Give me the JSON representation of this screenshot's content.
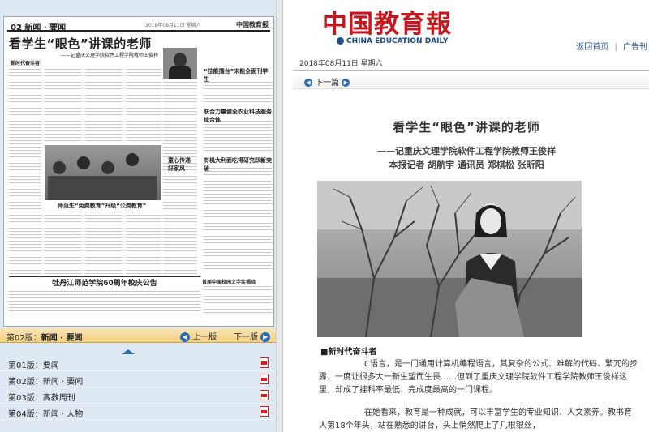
{
  "newspaper_thumb": {
    "edition": "02 新闻 · 要闻",
    "date": "2018年08月11日 星期六",
    "logo": "中国教育报",
    "headline": "看学生“眼色”讲课的老师",
    "subhead": "——记重庆文理学院软件工程学院教师王俊祥",
    "section_label": "新时代奋斗者",
    "side_headline": "“技能擂台”未能全面刊学生",
    "brief_1": "联合力量健全农业科技服务综合体",
    "brief_2": "有机大利面吃得研究跃新突破",
    "photo_caption": "师范生“免费教育”升级“公费教育”",
    "photo_title": "童心传递好家风",
    "announcement": "牡丹江师范学院60周年校庆公告",
    "announcement_2": "首届中国校园文学奖揭晓"
  },
  "page_nav": {
    "current_prefix": "第02版：",
    "current_name": "新闻 · 要闻",
    "prev_label": "上一版",
    "next_label": "下一版"
  },
  "page_list": [
    {
      "label": "第01版：要闻"
    },
    {
      "label": "第02版：新闻 · 要闻"
    },
    {
      "label": "第03版：高教周刊"
    },
    {
      "label": "第04版：新闻 · 人物"
    }
  ],
  "header": {
    "brand": "中国教育報",
    "brand_en": "CHINA EDUCATION DAILY",
    "home_link": "返回首页",
    "ad_link": "广告刊",
    "separator": "|",
    "date": "2018年08月11日 星期六",
    "next_article": "下一篇"
  },
  "article": {
    "title": "看学生“眼色”讲课的老师",
    "subtitle": "——记重庆文理学院软件工程学院教师王俊祥",
    "byline": "本报记者 胡航宇 通讯员 郑棋松 张昕阳",
    "section": "■新时代奋斗者",
    "paragraph_1": "C语言，是一门通用计算机编程语言，其复杂的公式、难解的代码、繁冗的步骤，一度让很多大一新生望而生畏……但到了重庆文理学院软件工程学院教师王俊祥这里，却成了挂科率最低、完成度最高的一门课程。",
    "paragraph_2": "在她看来，教育是一种成就，可以丰富学生的专业知识、人文素养。教书育人第18个年头，站在熟悉的讲台，头上悄然爬上了几根银丝，"
  },
  "colors": {
    "brand_red": "#c8161d",
    "brand_blue": "#1a4b8c",
    "nav_gold": "#f3cf7d",
    "left_bg": "#dfe9f4",
    "pdf_red": "#cc2222"
  }
}
